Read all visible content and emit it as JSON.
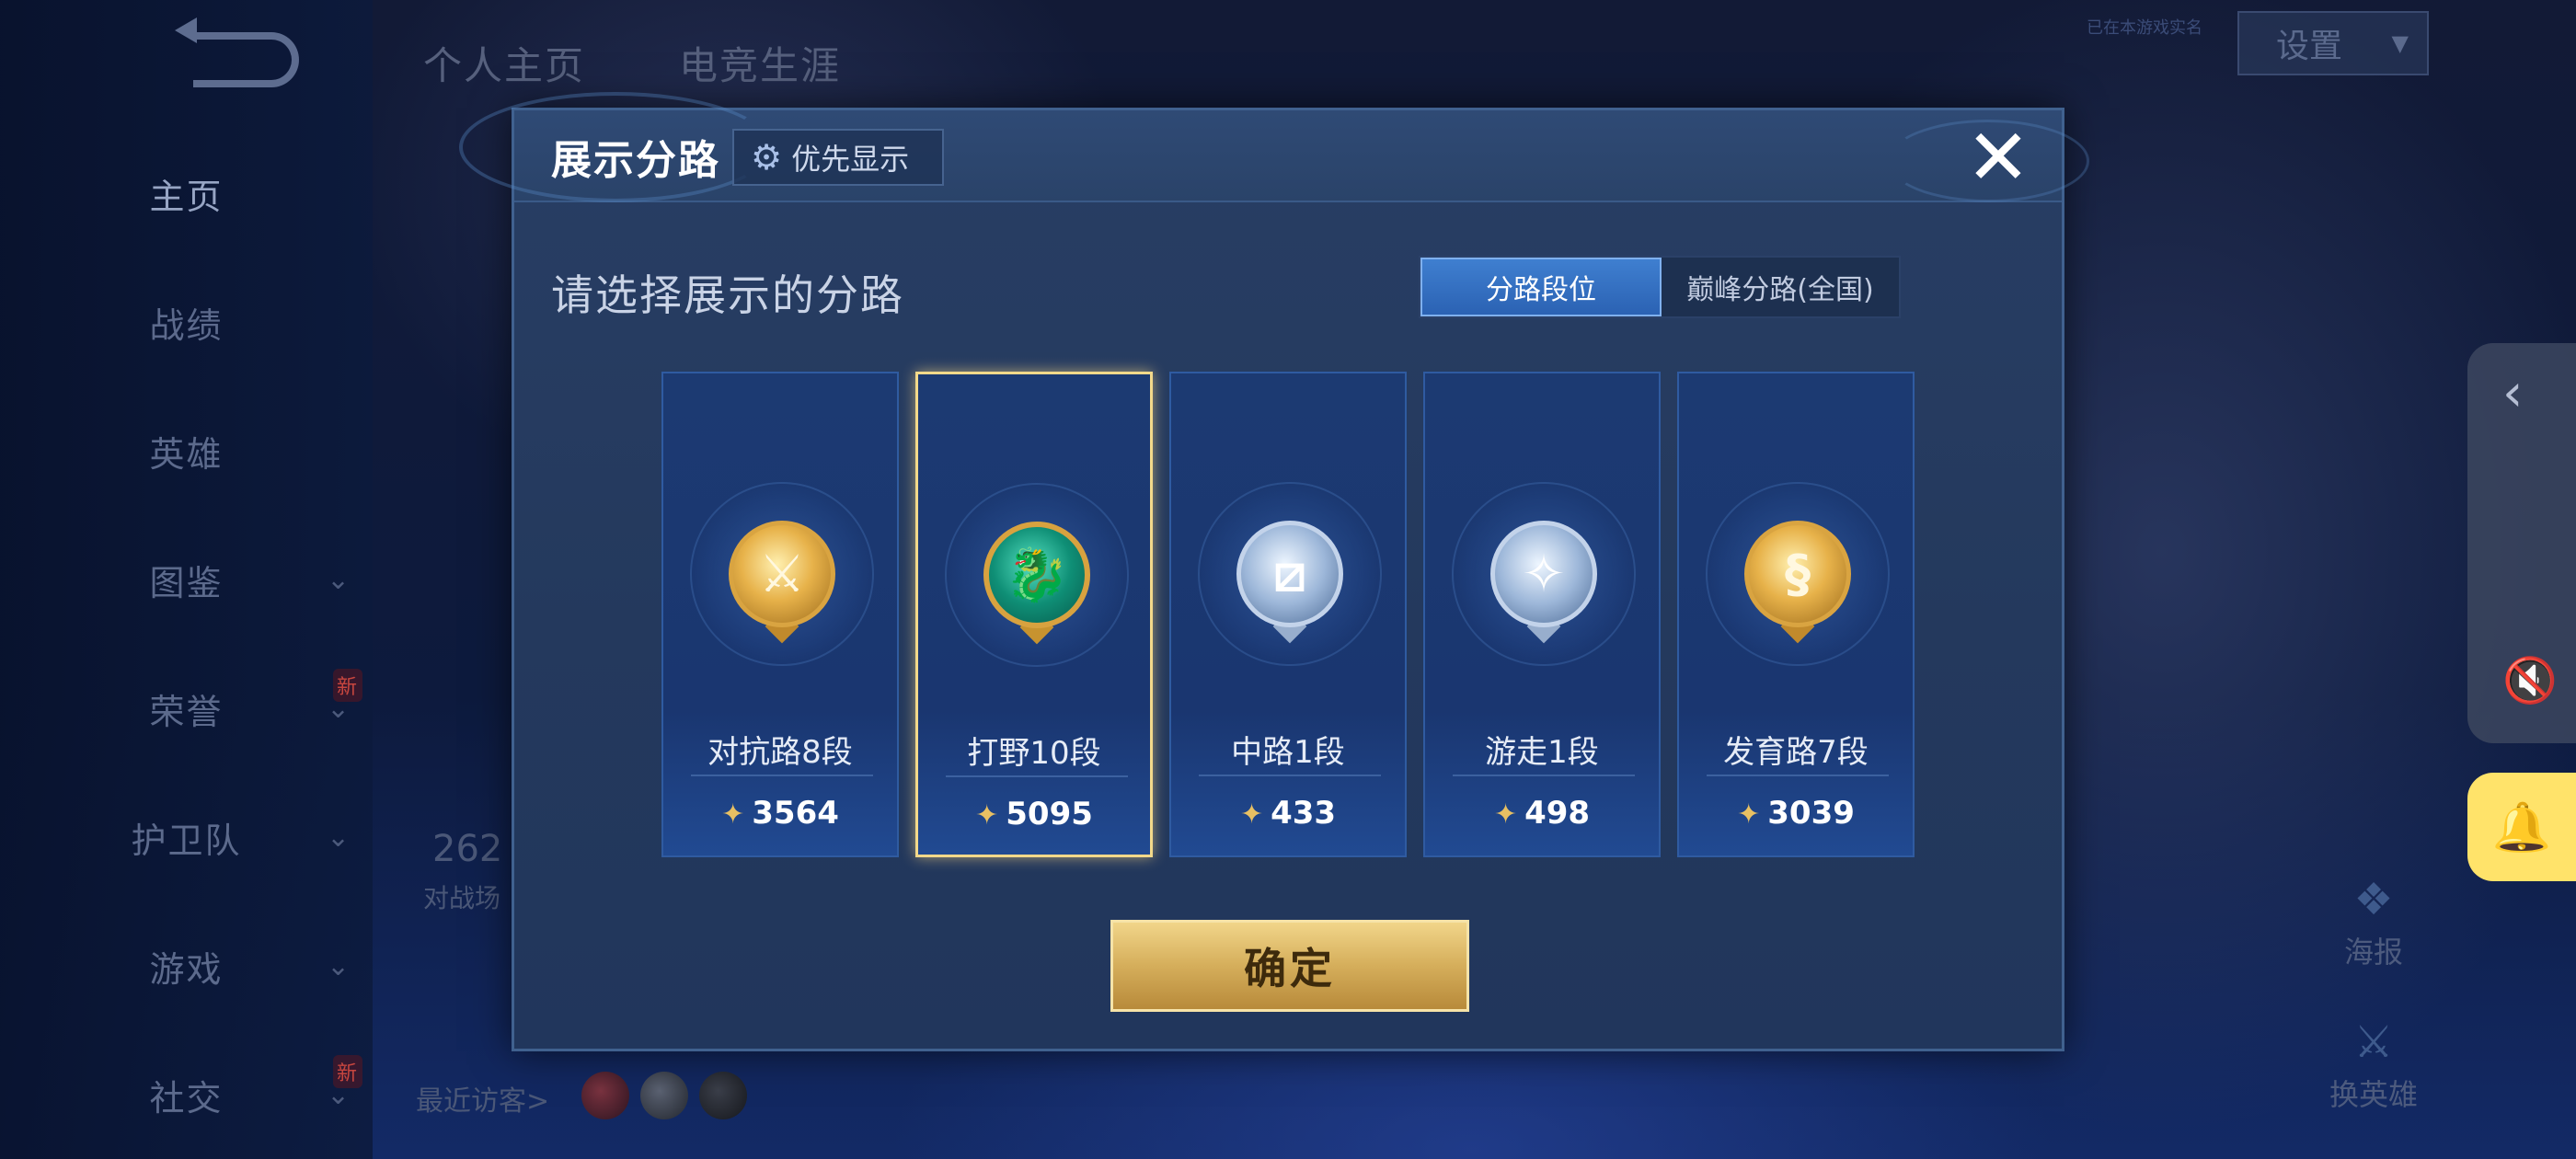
{
  "background": {
    "top_tabs": [
      "个人主页",
      "电竞生涯"
    ],
    "settings_label": "设置",
    "top_hint": "已在本游戏实名",
    "nav_items": [
      {
        "label": "主页",
        "active": true,
        "chevron": false,
        "new": false
      },
      {
        "label": "战绩",
        "active": false,
        "chevron": false,
        "new": false
      },
      {
        "label": "英雄",
        "active": false,
        "chevron": false,
        "new": false
      },
      {
        "label": "图鉴",
        "active": false,
        "chevron": true,
        "new": false
      },
      {
        "label": "荣誉",
        "active": false,
        "chevron": true,
        "new": true
      },
      {
        "label": "护卫队",
        "active": false,
        "chevron": true,
        "new": false
      },
      {
        "label": "游戏",
        "active": false,
        "chevron": true,
        "new": false
      },
      {
        "label": "社交",
        "active": false,
        "chevron": true,
        "new": true
      }
    ],
    "new_badge": "新",
    "stats_value": "262",
    "stats_label": "对战场",
    "visitors_label": "最近访客>",
    "right_actions": [
      "海报",
      "换英雄"
    ],
    "icons": {
      "chevron": "chevron-down-icon",
      "back": "back-arrow-icon",
      "mute": "mute-icon",
      "bell": "bell-icon"
    }
  },
  "modal": {
    "title": "展示分路",
    "priority_label": "优先显示",
    "close_icon": "close-icon",
    "subtitle": "请选择展示的分路",
    "tabs": [
      {
        "label": "分路段位",
        "active": true
      },
      {
        "label": "巅峰分路(全国)",
        "active": false
      }
    ],
    "cards": [
      {
        "label": "对抗路8段",
        "score": "3564",
        "badge": "gold",
        "selected": false
      },
      {
        "label": "打野10段",
        "score": "5095",
        "badge": "green",
        "selected": true
      },
      {
        "label": "中路1段",
        "score": "433",
        "badge": "silver",
        "selected": false
      },
      {
        "label": "游走1段",
        "score": "498",
        "badge": "silver",
        "selected": false
      },
      {
        "label": "发育路7段",
        "score": "3039",
        "badge": "gold",
        "selected": false
      }
    ],
    "confirm_label": "确定"
  },
  "colors": {
    "accent_gold": "#f3d98a",
    "tab_active": "#3f7fd0",
    "bell_yellow": "#ffe36a"
  }
}
